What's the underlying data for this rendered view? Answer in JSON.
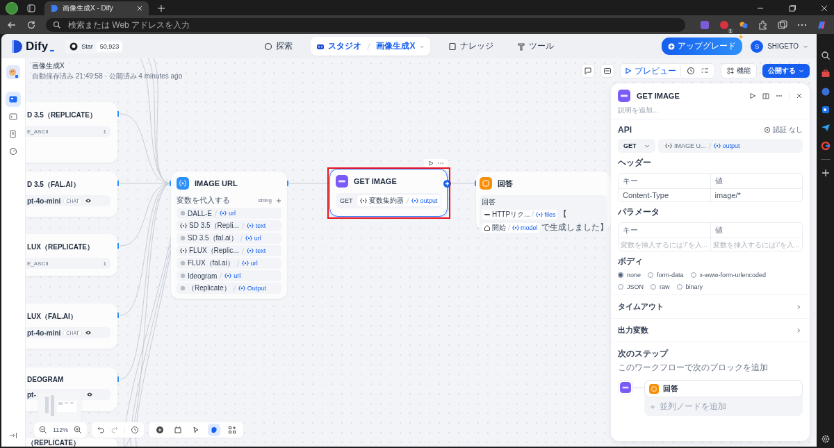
{
  "browser": {
    "tab_title": "画像生成X - Dify",
    "address_placeholder": "検索または Web アドレスを入力",
    "extension_badge": "1"
  },
  "header": {
    "logo": "Dify",
    "star_label": "Star",
    "star_count": "50,923",
    "nav": [
      {
        "label": "探索",
        "selected": false
      },
      {
        "label": "スタジオ",
        "selected": true,
        "sub": "画像生成X"
      },
      {
        "label": "ナレッジ",
        "selected": false
      },
      {
        "label": "ツール",
        "selected": false
      }
    ],
    "upgrade": "アップグレード",
    "avatar": "S",
    "user": "SHIGETO"
  },
  "app_info": {
    "name": "画像生成X",
    "status": "自動保存済み 21:49:58 · 公開済み 4 minutes ago"
  },
  "sidebar_items": [
    {
      "selected": true
    },
    {
      "selected": false
    },
    {
      "selected": false
    },
    {
      "selected": false
    }
  ],
  "toolbar": {
    "preview": "プレビュー",
    "features": "機能",
    "publish": "公開する"
  },
  "source_nodes": [
    {
      "title": "D 3.5（REPLICATE）",
      "kind": "variable",
      "field": "E_ASCII",
      "count": "1"
    },
    {
      "title": "D 3.5（FAL.AI）",
      "kind": "model",
      "model": "pt-4o-mini",
      "tag": "CHAT"
    },
    {
      "title": "LUX（REPLICATE）",
      "kind": "variable",
      "field": "E_ASCII",
      "count": "1"
    },
    {
      "title": "LUX（FAL.AI）",
      "kind": "model",
      "model": "pt-4o-mini",
      "tag": "CHAT"
    },
    {
      "title": "DEOGRAM",
      "kind": "model",
      "model": "pt-"
    },
    {
      "title": "（REPLICATE）",
      "kind": "title"
    }
  ],
  "image_url_node": {
    "title": "IMAGE URL",
    "label": "変数を代入する",
    "type": "string",
    "rows": [
      {
        "kind": "node",
        "source": "DALL-E",
        "var": "url"
      },
      {
        "kind": "variable",
        "source": "SD 3.5（Repli...",
        "var": "text"
      },
      {
        "kind": "node",
        "source": "SD 3.5（fal.ai）",
        "var": "url"
      },
      {
        "kind": "variable",
        "source": "FLUX（Replic...",
        "var": "text"
      },
      {
        "kind": "node",
        "source": "FLUX（fal.ai）",
        "var": "url"
      },
      {
        "kind": "node",
        "source": "Ideogram",
        "var": "url"
      },
      {
        "kind": "node",
        "source": "（Replicate）",
        "var": "Output"
      }
    ]
  },
  "get_image_node": {
    "title": "GET IMAGE",
    "method": "GET",
    "source": "変数集約器",
    "var": "output",
    "selected": true
  },
  "answer_node": {
    "title": "回答",
    "label": "回答",
    "lines": [
      {
        "kind": "http",
        "ref": "HTTPリク...",
        "var": "files",
        "suffix": "【"
      },
      {
        "kind": "start",
        "ref": "開始",
        "var": "model",
        "suffix": "で生成しました】"
      }
    ]
  },
  "panel": {
    "title": "GET IMAGE",
    "description_placeholder": "説明を追加...",
    "api_label": "API",
    "auth": "認証 なし",
    "method": "GET",
    "url_source": "IMAGE U...",
    "url_var": "output",
    "headers_label": "ヘッダー",
    "headers": {
      "columns": [
        "キー",
        "値"
      ],
      "rows": [
        [
          "Content-Type",
          "image/*"
        ]
      ]
    },
    "params_label": "パラメータ",
    "params": {
      "columns": [
        "キー",
        "値"
      ],
      "placeholders": [
        "変数を挿入するには'/'を入...",
        "変数を挿入するには'/'を入..."
      ]
    },
    "body_label": "ボディ",
    "body_options": [
      {
        "label": "none",
        "selected": true
      },
      {
        "label": "form-data",
        "selected": false
      },
      {
        "label": "x-www-form-urlencoded",
        "selected": false
      },
      {
        "label": "JSON",
        "selected": false
      },
      {
        "label": "raw",
        "selected": false
      },
      {
        "label": "binary",
        "selected": false
      }
    ],
    "sections": [
      "タイムアウト",
      "出力変数"
    ],
    "next_step": {
      "title": "次のステップ",
      "subtitle": "このワークフローで次のブロックを追加",
      "block": "回答",
      "add_parallel": "並列ノードを追加"
    }
  },
  "zoom": "112%",
  "tools": [
    {
      "selected": false
    },
    {
      "selected": false
    },
    {
      "selected": false
    },
    {
      "selected": true
    },
    {
      "selected": false
    }
  ]
}
